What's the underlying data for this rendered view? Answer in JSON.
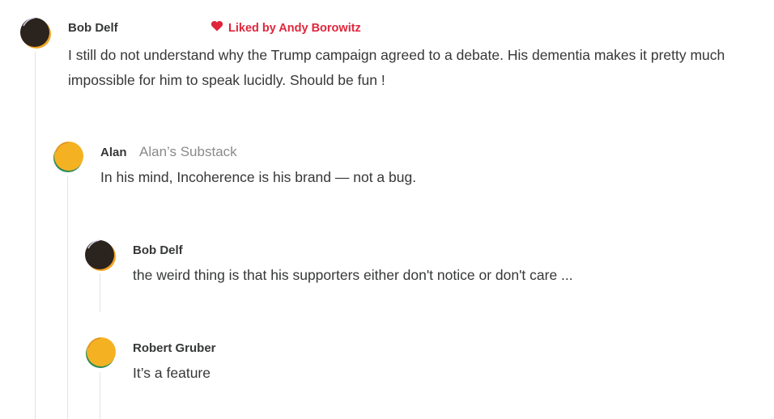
{
  "comments": [
    {
      "author": "Bob Delf",
      "liked_by": "Liked by Andy Borowitz",
      "text": "I still do not understand why the Trump campaign agreed to a debate. His dementia makes it pretty much impossible for him to speak lucidly. Should be fun !",
      "avatar": "dark-avatar"
    },
    {
      "author": "Alan",
      "publication": "Alan’s Substack",
      "text": "In his mind, Incoherence is his brand — not a bug.",
      "avatar": "yellow-avatar"
    },
    {
      "author": "Bob Delf",
      "text": "the weird thing is that his supporters either don't notice or don't care ...",
      "avatar": "dark-avatar"
    },
    {
      "author": "Robert Gruber",
      "text": "It’s a feature",
      "avatar": "yellow-avatar"
    }
  ],
  "colors": {
    "liked_accent": "#e0263c",
    "thread_line": "#e3e3e3",
    "text": "#363737",
    "muted": "#8a8a8a"
  }
}
